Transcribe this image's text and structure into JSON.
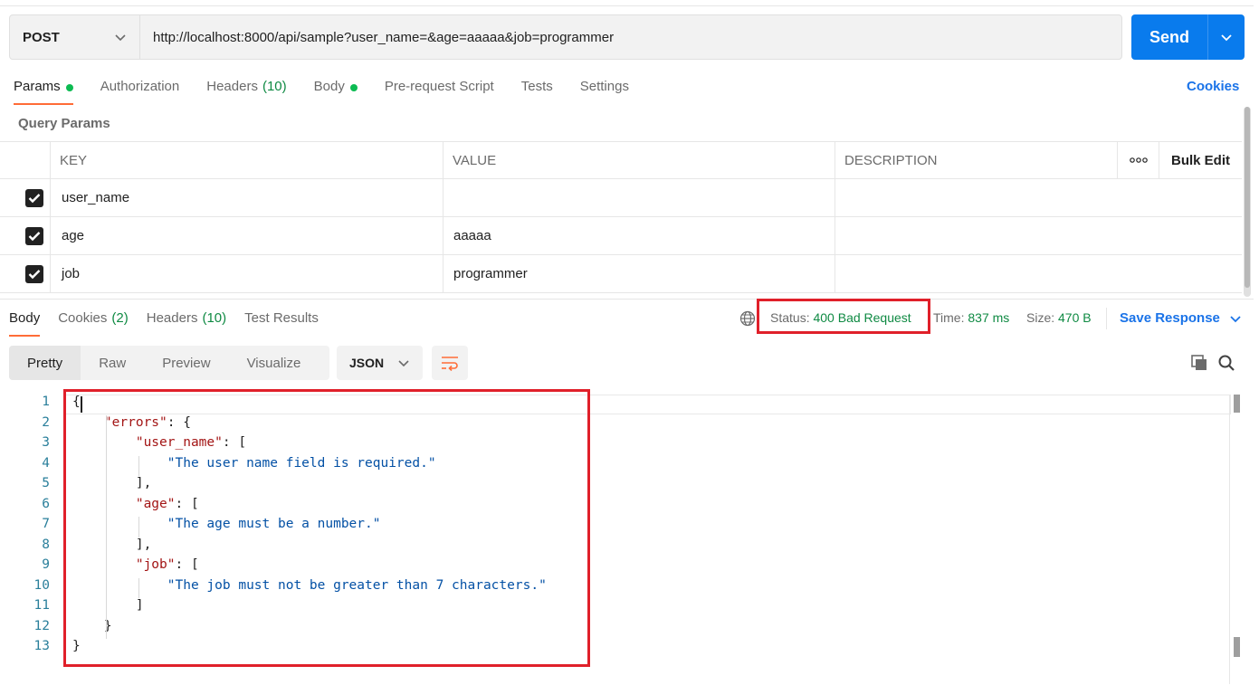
{
  "request": {
    "method": "POST",
    "url": "http://localhost:8000/api/sample?user_name=&age=aaaaa&job=programmer",
    "send_label": "Send"
  },
  "request_tabs": [
    {
      "label": "Params",
      "dot": true,
      "count": ""
    },
    {
      "label": "Authorization",
      "dot": false,
      "count": ""
    },
    {
      "label": "Headers",
      "dot": false,
      "count": "(10)"
    },
    {
      "label": "Body",
      "dot": true,
      "count": ""
    },
    {
      "label": "Pre-request Script",
      "dot": false,
      "count": ""
    },
    {
      "label": "Tests",
      "dot": false,
      "count": ""
    },
    {
      "label": "Settings",
      "dot": false,
      "count": ""
    }
  ],
  "cookies_link": "Cookies",
  "query_params": {
    "title": "Query Params",
    "headers": {
      "key": "KEY",
      "value": "VALUE",
      "description": "DESCRIPTION",
      "bulk_edit": "Bulk Edit"
    },
    "rows": [
      {
        "checked": true,
        "key": "user_name",
        "value": "",
        "description": ""
      },
      {
        "checked": true,
        "key": "age",
        "value": "aaaaa",
        "description": ""
      },
      {
        "checked": true,
        "key": "job",
        "value": "programmer",
        "description": ""
      }
    ]
  },
  "response_tabs": [
    {
      "label": "Body",
      "count": ""
    },
    {
      "label": "Cookies",
      "count": "(2)"
    },
    {
      "label": "Headers",
      "count": "(10)"
    },
    {
      "label": "Test Results",
      "count": ""
    }
  ],
  "response_meta": {
    "status_label": "Status:",
    "status_value": "400 Bad Request",
    "time_label": "Time:",
    "time_value": "837 ms",
    "size_label": "Size:",
    "size_value": "470 B",
    "save_response": "Save Response"
  },
  "view_modes": [
    "Pretty",
    "Raw",
    "Preview",
    "Visualize"
  ],
  "format": "JSON",
  "colors": {
    "accent": "#ff6c37",
    "send": "#097bed",
    "status_ok": "#0f8a43",
    "highlight": "#e0202a"
  },
  "code_lines": [
    {
      "n": "1",
      "text": "{"
    },
    {
      "n": "2",
      "text": "    \"errors\": {"
    },
    {
      "n": "3",
      "text": "        \"user_name\": ["
    },
    {
      "n": "4",
      "text": "            \"The user name field is required.\""
    },
    {
      "n": "5",
      "text": "        ],"
    },
    {
      "n": "6",
      "text": "        \"age\": ["
    },
    {
      "n": "7",
      "text": "            \"The age must be a number.\""
    },
    {
      "n": "8",
      "text": "        ],"
    },
    {
      "n": "9",
      "text": "        \"job\": ["
    },
    {
      "n": "10",
      "text": "            \"The job must not be greater than 7 characters.\""
    },
    {
      "n": "11",
      "text": "        ]"
    },
    {
      "n": "12",
      "text": "    }"
    },
    {
      "n": "13",
      "text": "}"
    }
  ]
}
